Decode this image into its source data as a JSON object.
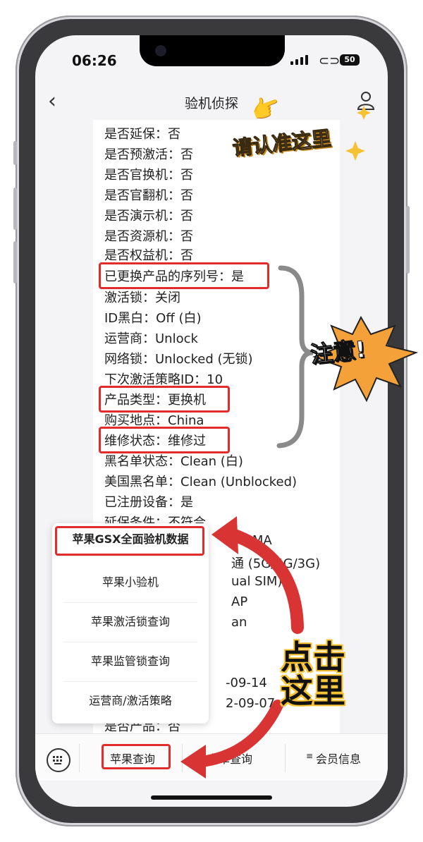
{
  "status": {
    "time": "06:26",
    "battery": "50"
  },
  "nav": {
    "title": "验机侦探"
  },
  "report_lines": [
    "是否延保：否",
    "是否预激活：否",
    "是否官换机：否",
    "是否官翻机：否",
    "是否演示机：否",
    "是否资源机：否",
    "是否权益机：否",
    "已更换产品的序列号：是",
    "激活锁：关闭",
    "ID黑白：Off (白)",
    "运营商：Unlock",
    "网络锁：Unlocked (无锁)",
    "下次激活策略ID：10",
    "产品类型：更换机",
    "购买地点：China",
    "维修状态：维修过",
    "黑名单状态：Clean (白)",
    "美国黑名单：Clean (Unblocked)",
    "已注册设备：是",
    "延保条件：不符合",
    "DMA",
    "通 (5G/4G/3G)",
    "ual SIM)",
    "AP",
    "an",
    "",
    "-09-14",
    "2-09-07",
    "是否产品：否"
  ],
  "menu": {
    "items": [
      "苹果GSX全面验机数据",
      "苹果小验机",
      "苹果激活锁查询",
      "苹果监管锁查询",
      "运营商/激活策略"
    ]
  },
  "tabbar": {
    "apple": "苹果查询",
    "android": "安卓查询",
    "member": "会员信息"
  },
  "stickers": {
    "confirm": "请认准这里",
    "attention": "注意!",
    "click": "点击",
    "here": "这里"
  },
  "colors": {
    "highlight": "#e22b2b",
    "arrow": "#d93434",
    "sticker_yellow": "#f5c233"
  }
}
